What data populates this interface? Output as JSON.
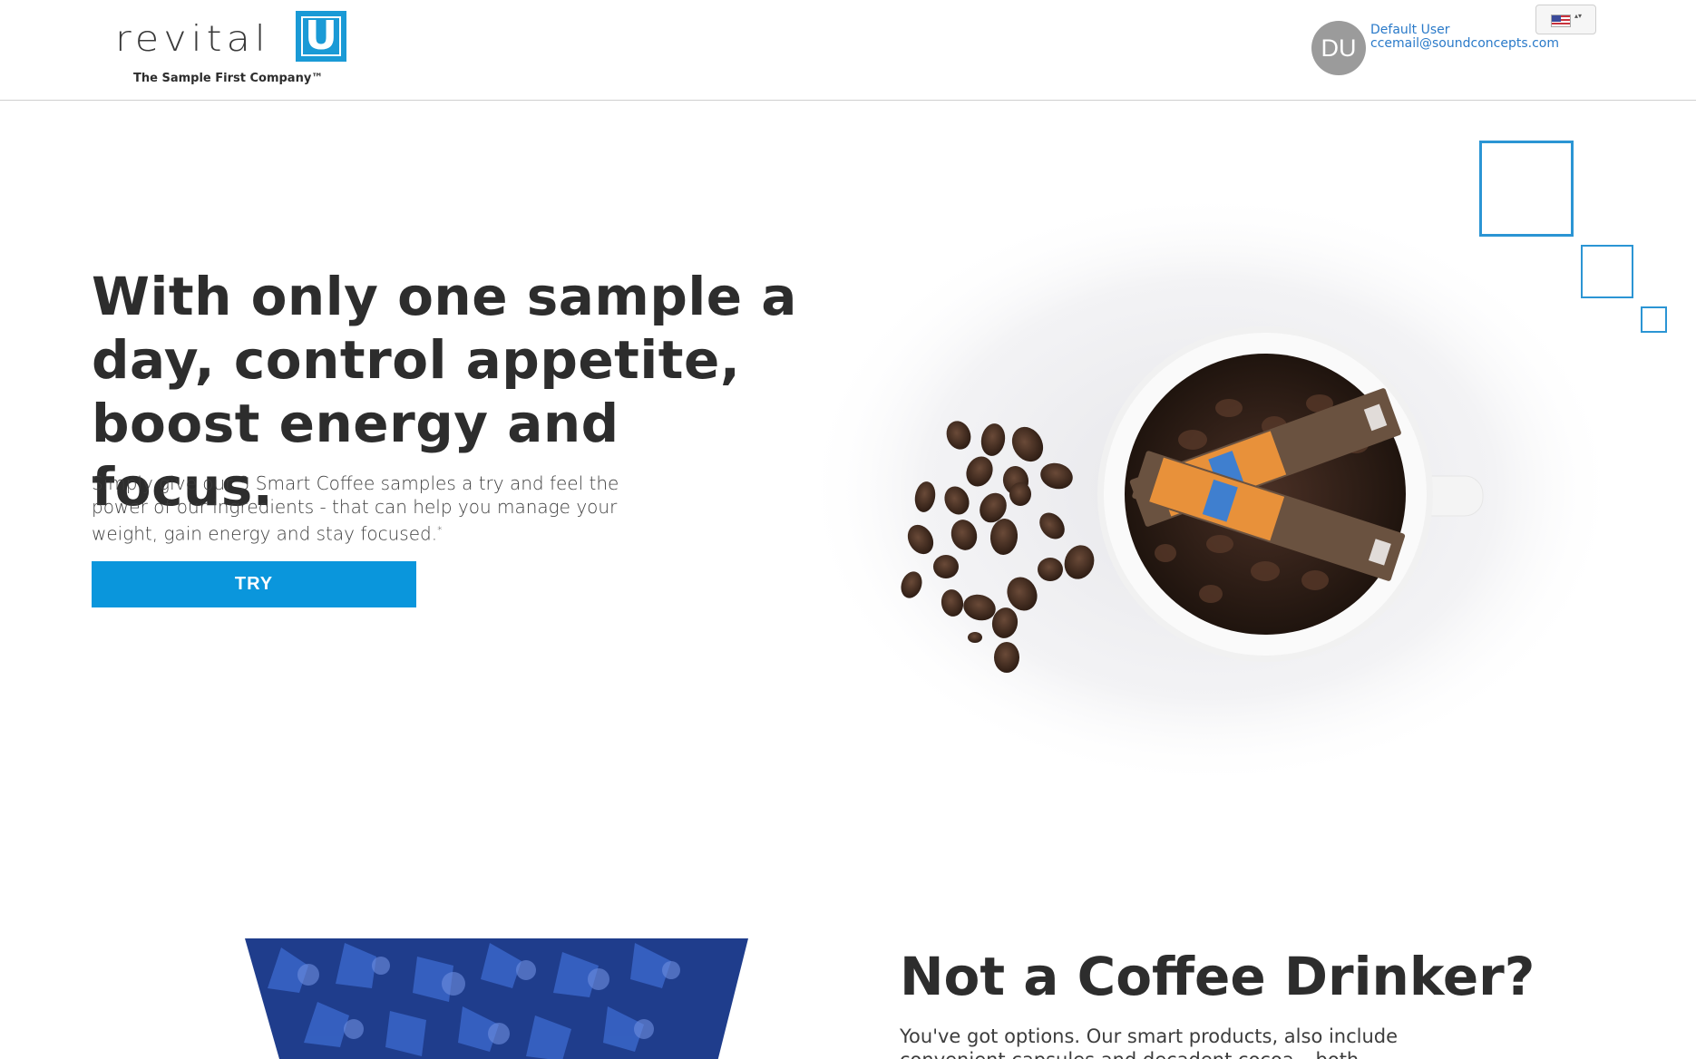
{
  "header": {
    "logo_word": "revital",
    "logo_letter": "U",
    "logo_tagline": "The Sample First Company™",
    "user": {
      "initials": "DU",
      "name": "Default User",
      "email": "ccemail@soundconcepts.com"
    },
    "language_select": {
      "icon": "us-flag-icon",
      "arrows": "▴▾"
    }
  },
  "hero": {
    "title": "With only one sample a day, control appetite, boost energy and focus.",
    "text": "Simply give our 3 Smart Coffee samples a try and feel the power of our ingredients - that can help you manage your weight, gain energy and stay focused.",
    "text_marker": "*",
    "try_label": "TRY",
    "image_description": "coffee-cup-with-beans-and-sticks"
  },
  "section2": {
    "title": "Not a Coffee Drinker?",
    "text": "You've got options. Our smart products, also include convenient capsules and decadent cocoa – both"
  },
  "colors": {
    "accent": "#0a96dc",
    "link": "#2a7ac9",
    "text": "#2d2d2d",
    "avatar": "#9b9b9b"
  }
}
